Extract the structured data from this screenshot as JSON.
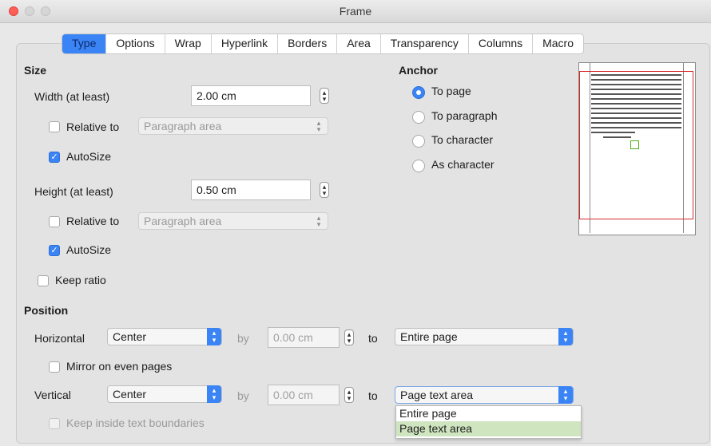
{
  "window": {
    "title": "Frame"
  },
  "tabs": [
    "Type",
    "Options",
    "Wrap",
    "Hyperlink",
    "Borders",
    "Area",
    "Transparency",
    "Columns",
    "Macro"
  ],
  "active_tab": "Type",
  "size": {
    "heading": "Size",
    "width_label": "Width (at least)",
    "width_value": "2.00 cm",
    "width_relative_label": "Relative to",
    "width_relative_checked": false,
    "width_relative_select": "Paragraph area",
    "width_autosize_label": "AutoSize",
    "width_autosize_checked": true,
    "height_label": "Height (at least)",
    "height_value": "0.50 cm",
    "height_relative_label": "Relative to",
    "height_relative_checked": false,
    "height_relative_select": "Paragraph area",
    "height_autosize_label": "AutoSize",
    "height_autosize_checked": true,
    "keep_ratio_label": "Keep ratio",
    "keep_ratio_checked": false
  },
  "anchor": {
    "heading": "Anchor",
    "options": [
      "To page",
      "To paragraph",
      "To character",
      "As character"
    ],
    "selected": "To page"
  },
  "position": {
    "heading": "Position",
    "horizontal_label": "Horizontal",
    "horizontal_value": "Center",
    "horizontal_by_label": "by",
    "horizontal_by_value": "0.00 cm",
    "horizontal_to_label": "to",
    "horizontal_to_value": "Entire page",
    "mirror_label": "Mirror on even pages",
    "mirror_checked": false,
    "vertical_label": "Vertical",
    "vertical_value": "Center",
    "vertical_by_label": "by",
    "vertical_by_value": "0.00 cm",
    "vertical_to_label": "to",
    "vertical_to_value": "Page text area",
    "keep_inside_label": "Keep inside text boundaries",
    "keep_inside_checked": false
  },
  "vertical_to_dropdown": {
    "options": [
      "Entire page",
      "Page text area"
    ],
    "highlighted": "Page text area"
  },
  "colors": {
    "accent": "#3b84f5",
    "close": "#fe5f57",
    "preview_border": "#d62b2b",
    "frame_marker": "#4caf1a",
    "dropdown_highlight": "#cfe5c0"
  }
}
